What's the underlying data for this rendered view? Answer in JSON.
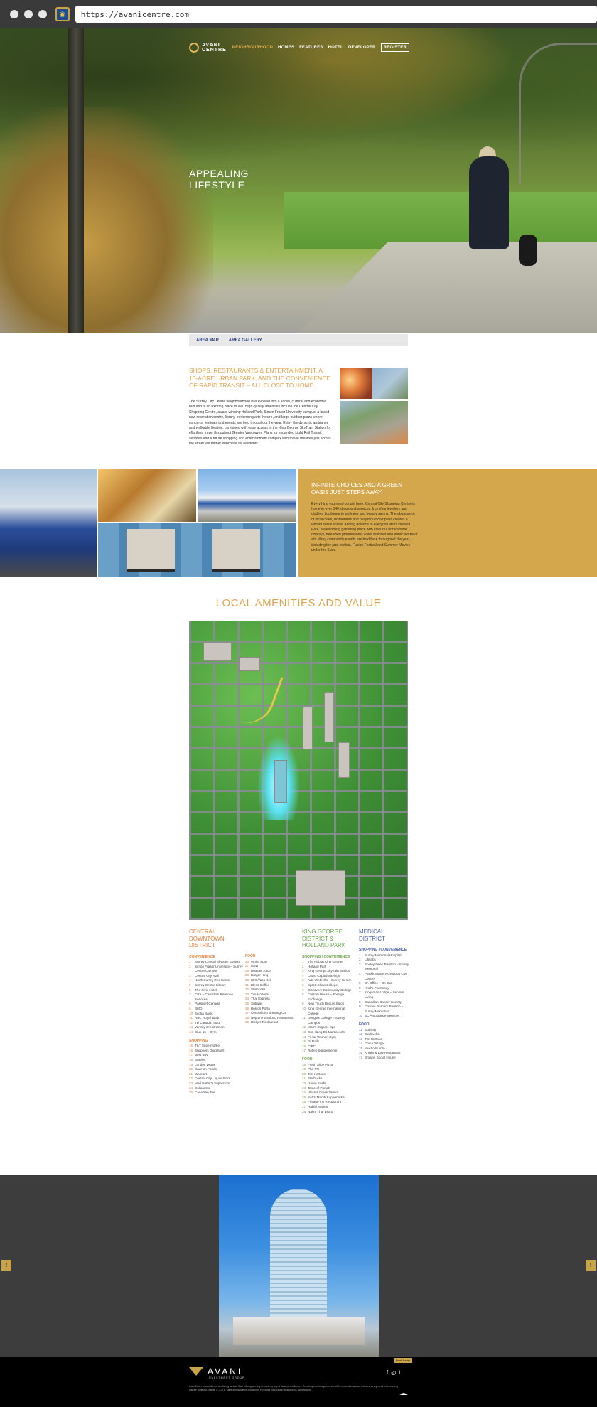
{
  "browser": {
    "url": "https://avanicentre.com"
  },
  "nav": {
    "logo_line1": "AVANI",
    "logo_line2": "CENTRE",
    "items": [
      "NEIGHBOURHOOD",
      "HOMES",
      "FEATURES",
      "HOTEL",
      "DEVELOPER"
    ],
    "register": "REGISTER"
  },
  "hero": {
    "title_line1": "APPEALING",
    "title_line2": "LIFESTYLE"
  },
  "subtabs": [
    "AREA MAP",
    "AREA GALLERY"
  ],
  "intro": {
    "heading": "SHOPS, RESTAURANTS & ENTERTAINMENT, A 10-ACRE URBAN PARK, AND THE CONVENIENCE OF RAPID TRANSIT – ALL CLOSE TO HOME.",
    "body": "The Surrey City Centre neighbourhood has evolved into a social, cultural and economic hub and is an exciting place to live. High-quality amenities include the Central City Shopping Centre, award-winning Holland Park, Simon Fraser University campus, a brand new recreation centre, library, performing arts theatre, and large outdoor plaza where concerts, festivals and events are held throughout the year. Enjoy the dynamic ambiance and walkable lifestyle, combined with easy access to the King George SkyTrain Station for effortless travel throughout Greater Vancouver. Plans for expanded Light Rail Transit services and a future shopping and entertainment complex with movie theatres just across the street will further enrich life for residents."
  },
  "band": {
    "heading": "INFINITE CHOICES AND A GREEN OASIS JUST STEPS AWAY.",
    "body": "Everything you need is right here. Central City Shopping Centre is home to over 140 shops and services, from fine jewelers and clothing boutiques to wellness and beauty salons. The abundance of local cafes, restaurants and neighbourhood pubs creates a vibrant social scene. Adding balance to everyday life is Holland Park, a welcoming gathering place with colourful horticultural displays, tree-lined promenades, water features and public works of art. Many community events are held here throughout the year, including the jazz festival, Fusion Festival and Summer Movies under the Stars."
  },
  "amenities": {
    "title": "LOCAL AMENITIES ADD VALUE",
    "central": {
      "heading": "CENTRAL DOWNTOWN DISTRICT",
      "convenience_label": "CONVENIENCE",
      "convenience": [
        [
          "1",
          "Surrey Central Skytrain Station"
        ],
        [
          "2",
          "Simon Fraser University – Surrey Centre Campus"
        ],
        [
          "3",
          "Central City Mall"
        ],
        [
          "4",
          "North Surrey Rec Centre"
        ],
        [
          "5",
          "Surrey Centre Library"
        ],
        [
          "6",
          "The Civic Hotel"
        ],
        [
          "7",
          "CRA – Canadian Revenue Services"
        ],
        [
          "8",
          "Passport Canada"
        ],
        [
          "9",
          "BMO"
        ],
        [
          "10",
          "Scotia Bank"
        ],
        [
          "11",
          "RBC Royal Bank"
        ],
        [
          "12",
          "TD Canada Trust"
        ],
        [
          "13",
          "Vancity Credit Union"
        ],
        [
          "14",
          "Club 16 – Gym"
        ]
      ],
      "shopping_label": "SHOPPING",
      "shopping": [
        [
          "15",
          "T&T Supermarket"
        ],
        [
          "16",
          "Shoppers Drug Mart"
        ],
        [
          "17",
          "Best Buy"
        ],
        [
          "18",
          "Staples"
        ],
        [
          "19",
          "London Drugs"
        ],
        [
          "20",
          "Save on Foods"
        ],
        [
          "21",
          "Walmart"
        ],
        [
          "22",
          "Central City Liquor Store"
        ],
        [
          "23",
          "Mad Hatter's Superstore"
        ],
        [
          "24",
          "Dollarama"
        ],
        [
          "25",
          "Canadian Tire"
        ]
      ],
      "food_label": "FOOD",
      "food": [
        [
          "26",
          "White Spot"
        ],
        [
          "27",
          "A&W"
        ],
        [
          "28",
          "Booster Juice"
        ],
        [
          "29",
          "Burger King"
        ],
        [
          "30",
          "KFC/Taco Bell"
        ],
        [
          "31",
          "Blenz Coffee"
        ],
        [
          "32",
          "Starbucks"
        ],
        [
          "33",
          "Tim Hortons"
        ],
        [
          "34",
          "Thai Express"
        ],
        [
          "35",
          "Subway"
        ],
        [
          "36",
          "Boston Pizza"
        ],
        [
          "37",
          "Central City Brewing Co."
        ],
        [
          "38",
          "Neptune Seafood Restaurant"
        ],
        [
          "39",
          "Ricky's Restaurant"
        ]
      ]
    },
    "kinggeorge": {
      "heading": "KING GEORGE DISTRICT & HOLLAND PARK",
      "convenience_label": "SHOPPING / CONVENIENCE",
      "convenience": [
        [
          "1",
          "The Hub at King George"
        ],
        [
          "2",
          "Holland Park"
        ],
        [
          "3",
          "King George Skytrain Station"
        ],
        [
          "4",
          "Coast Capital Savings"
        ],
        [
          "5",
          "Arts Umbrella – Surrey Centre"
        ],
        [
          "6",
          "Sprott Shaw College"
        ],
        [
          "7",
          "Discovery Community College"
        ],
        [
          "8",
          "Custom House – Foreign Exchange"
        ],
        [
          "9",
          "New Touch Beauty Salon"
        ],
        [
          "10",
          "King George International College"
        ],
        [
          "11",
          "Douglas College – Surrey Campus"
        ],
        [
          "12",
          "Mira's Organic Spa"
        ],
        [
          "13",
          "Sun Hang Do Martial Arts"
        ],
        [
          "14",
          "Fit for Women Gym"
        ],
        [
          "15",
          "DI Nails"
        ],
        [
          "16",
          "CIBC"
        ],
        [
          "17",
          "Reflex Supplements"
        ]
      ],
      "food_label": "FOOD",
      "food": [
        [
          "18",
          "Fresh Slice Pizza"
        ],
        [
          "19",
          "Pho PR"
        ],
        [
          "20",
          "Tim Hortons"
        ],
        [
          "21",
          "Starbucks"
        ],
        [
          "22",
          "Izumo Sushi"
        ],
        [
          "23",
          "Taste of Punjab"
        ],
        [
          "24",
          "Vlassis Greek Tavern"
        ],
        [
          "25",
          "Sabzi Mandi Supermarket"
        ],
        [
          "26",
          "Fireago Inn Restaurant"
        ],
        [
          "27",
          "Habibi Market"
        ],
        [
          "28",
          "Nahm Thai Bistro"
        ]
      ]
    },
    "medical": {
      "heading": "MEDICAL DISTRICT",
      "convenience_label": "SHOPPING / CONVENIENCE",
      "convenience": [
        [
          "1",
          "Surrey Memorial Hospital"
        ],
        [
          "2",
          "Lifelabs"
        ],
        [
          "3",
          "Shirley Dean Pavilion – Surrey Memorial"
        ],
        [
          "4",
          "Plaskit Surgery Group at City Centre"
        ],
        [
          "5",
          "Dr. Office – Dr. Cox"
        ],
        [
          "6",
          "Kroll's Pharmacy"
        ],
        [
          "7",
          "Kingsman Lodge – Seniors Living"
        ],
        [
          "8",
          "Canadian Cancer Society"
        ],
        [
          "9",
          "Charles Barham Pavilion – Surrey Memorial"
        ],
        [
          "10",
          "BC Ambulance Services"
        ]
      ],
      "food_label": "FOOD",
      "food": [
        [
          "11",
          "Subway"
        ],
        [
          "12",
          "Starbucks"
        ],
        [
          "13",
          "Tim Hortons"
        ],
        [
          "14",
          "China Village"
        ],
        [
          "15",
          "Mucho Burrito"
        ],
        [
          "16",
          "Knight & Day Restaurant"
        ],
        [
          "17",
          "Browns Social House"
        ]
      ]
    }
  },
  "gallery": {
    "prev": "‹",
    "next": "›"
  },
  "footer": {
    "brand": "AVANI",
    "brand_sub": "INVESTMENT GROUP",
    "badge": "Book today",
    "social": [
      "f",
      "◎",
      "t"
    ],
    "legal": "Avani Centre is currently not an offering for sale. Such offering can only be made by way of disclosure statement. Renderings and images are an artist's conception and are intended as a general reference only and are subject to change. E. & O.E. Sales and marketing provided by PMI Avani Real Estate Marketing Inc. Whitestar.ca"
  },
  "colors": {
    "gold": "#d4a74d",
    "accent_orange": "#e2a34b",
    "green": "#6aa84f",
    "blue": "#4a5ea8",
    "nav_blue": "#263e7a"
  }
}
